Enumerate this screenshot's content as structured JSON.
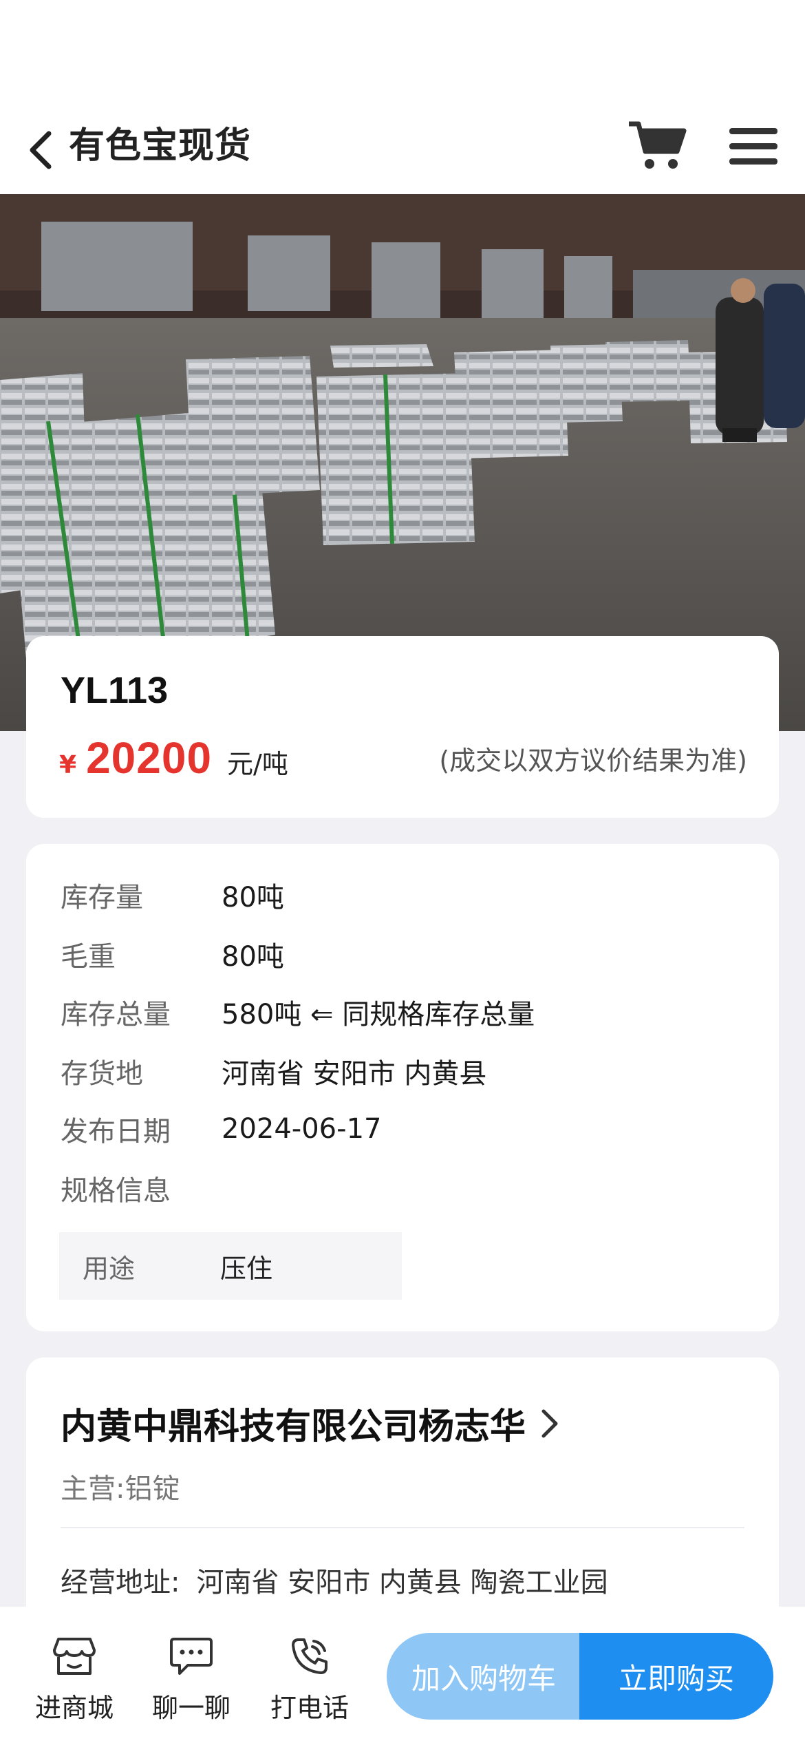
{
  "header": {
    "title": "有色宝现货",
    "back_icon": "chevron-left-icon",
    "cart_icon": "cart-icon",
    "menu_icon": "hamburger-menu-icon"
  },
  "hero": {
    "image": "warehouse photo of stacked aluminum ingot bundles"
  },
  "product": {
    "name": "YL113",
    "currency_symbol": "¥",
    "price": "20200",
    "unit": "元/吨",
    "note": "(成交以双方议价结果为准)"
  },
  "details": [
    {
      "label": "库存量",
      "value": "80吨"
    },
    {
      "label": "毛重",
      "value": "80吨"
    },
    {
      "label": "库存总量",
      "value": "580吨 ⇐ 同规格库存总量"
    },
    {
      "label": "存货地",
      "value": "河南省 安阳市 内黄县"
    },
    {
      "label": "发布日期",
      "value": "2024-06-17"
    },
    {
      "label": "规格信息",
      "value": ""
    }
  ],
  "spec": {
    "label": "用途",
    "value": "压住"
  },
  "company": {
    "name": "内黄中鼎科技有限公司杨志华",
    "main_business": "主营:铝锭",
    "address_label": "经营地址:",
    "address": "河南省 安阳市 内黄县 陶瓷工业园"
  },
  "bottom_bar": {
    "shop_label": "进商城",
    "chat_label": "聊一聊",
    "phone_label": "打电话",
    "add_to_cart_label": "加入购物车",
    "buy_now_label": "立即购买"
  },
  "colors": {
    "price_red": "#e5332d",
    "cart_button": "#8ec7f6",
    "buy_button": "#1f8ef1",
    "page_background": "#f1f1f5"
  }
}
